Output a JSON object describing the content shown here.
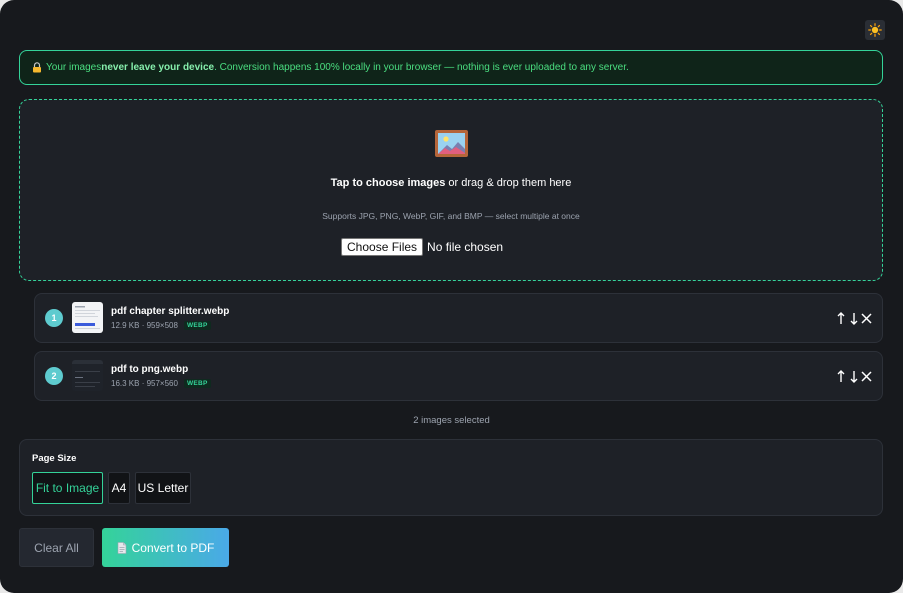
{
  "theme_toggle": {
    "icon": "sun-icon"
  },
  "privacy_notice": {
    "icon": "lock-icon",
    "prefix": "Your images ",
    "emphasis": "never leave your device",
    "suffix": ". Conversion happens 100% locally in your browser — nothing is ever uploaded to any server."
  },
  "dropzone": {
    "icon": "framed-picture-icon",
    "title_bold": "Tap to choose images",
    "title_rest": " or drag & drop them here",
    "hint": "Supports JPG, PNG, WebP, GIF, and BMP — select multiple at once",
    "choose_label": "Choose Files",
    "no_file_label": "No file chosen"
  },
  "files": [
    {
      "index": "1",
      "name": "pdf chapter splitter.webp",
      "meta": "12.9 KB · 959×508",
      "format": "WEBP"
    },
    {
      "index": "2",
      "name": "pdf to png.webp",
      "meta": "16.3 KB · 957×560",
      "format": "WEBP"
    }
  ],
  "controls": {
    "up": "↑",
    "down": "↓",
    "remove": "✕"
  },
  "selection_count": "2 images selected",
  "page_size": {
    "label": "Page Size",
    "options": [
      "Fit to Image",
      "A4",
      "US Letter"
    ],
    "selected": "Fit to Image"
  },
  "actions": {
    "clear_label": "Clear All",
    "convert_label": "Convert to PDF",
    "convert_icon": "document-icon"
  },
  "colors": {
    "accent": "#34d399",
    "accent_blue": "#4aa9e8",
    "background": "#17191d",
    "panel": "#1e2127"
  }
}
